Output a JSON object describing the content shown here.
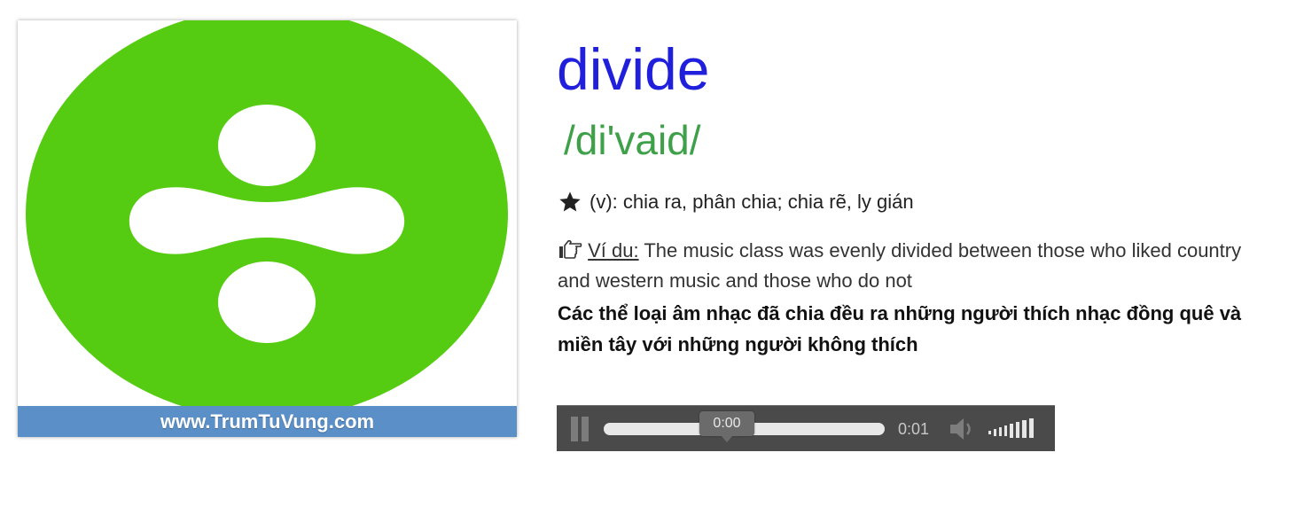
{
  "card": {
    "site": "www.TrumTuVung.com",
    "icon": "divide-logo-icon",
    "logo_color": "#55cc11",
    "bar_color": "#5b8fc7"
  },
  "entry": {
    "word": "divide",
    "phonetic": "/di'vaid/",
    "meaning": "(v): chia ra, phân chia; chia rẽ, ly gián",
    "example_label": "Ví du:",
    "example_text": " The music class was evenly divided between those who liked country and western music and those who do not",
    "translation": "Các thể loại âm nhạc đã chia đều ra những người thích nhạc đồng quê và miền tây với những người không thích",
    "word_color": "#1f1fdc",
    "phonetic_color": "#3fa04a"
  },
  "player": {
    "current_time": "0:00",
    "duration": "0:01",
    "state": "playing",
    "volume_level": 1.0
  }
}
